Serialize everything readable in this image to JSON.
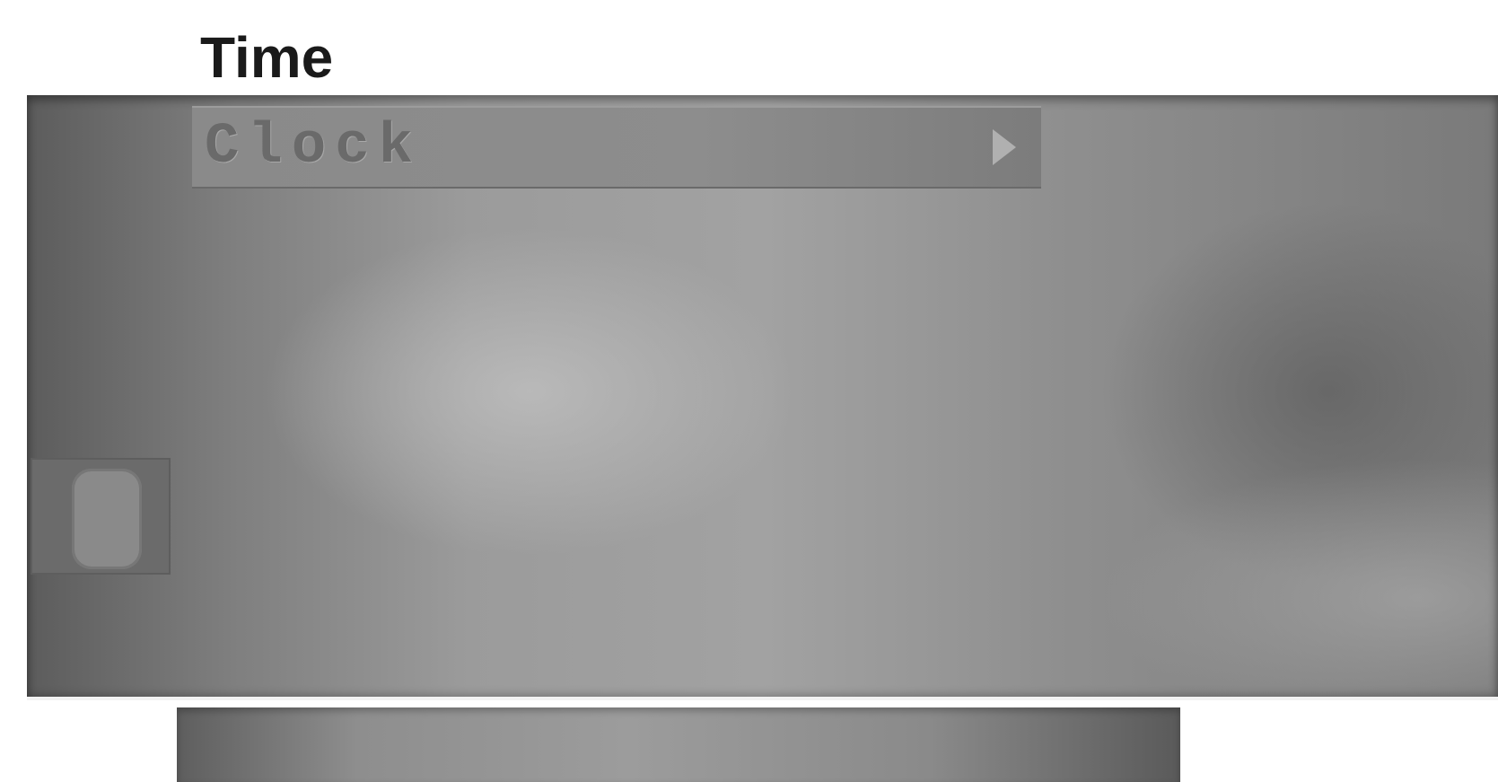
{
  "page": {
    "title": "Time"
  },
  "menu": {
    "items": [
      {
        "label": "Clock",
        "has_submenu": true,
        "selected": true
      }
    ]
  },
  "icons": {
    "submenu_arrow": "triangle-right-icon",
    "side_indicator": "tv-screen-icon"
  },
  "colors": {
    "title_text": "#1a1a1a",
    "panel_base": "#9b9b9b",
    "menu_item_bg": "#8a8a8a",
    "menu_item_text": "#6a6a6a"
  }
}
